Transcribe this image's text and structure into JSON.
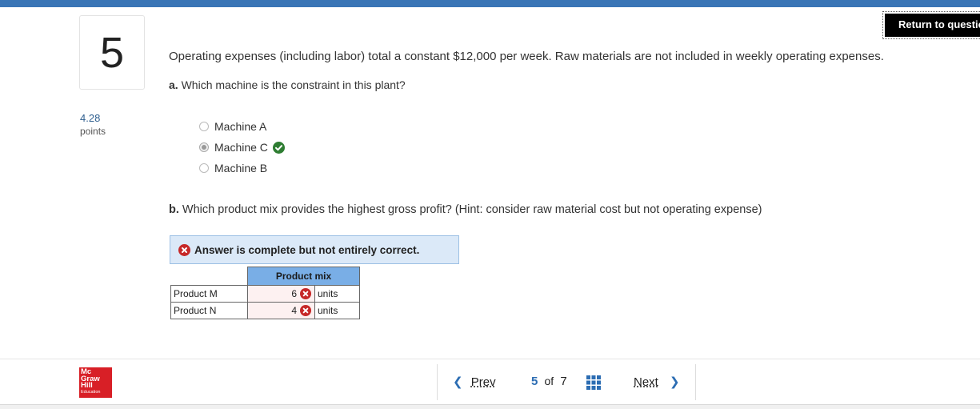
{
  "header": {
    "return_label": "Return to question"
  },
  "question": {
    "number": "5",
    "points_value": "4.28",
    "points_label": "points",
    "intro": "Operating expenses (including labor) total a constant $12,000 per week. Raw materials are not included in weekly operating expenses.",
    "part_a": {
      "prefix": "a.",
      "text": "Which machine is the constraint in this plant?",
      "options": [
        {
          "label": "Machine A",
          "selected": false
        },
        {
          "label": "Machine C",
          "selected": true,
          "correct": true
        },
        {
          "label": "Machine B",
          "selected": false
        }
      ]
    },
    "part_b": {
      "prefix": "b.",
      "text": "Which product mix provides the highest gross profit? (Hint: consider raw material cost but not operating expense)",
      "feedback": "Answer is complete but not entirely correct.",
      "table": {
        "header": "Product mix",
        "rows": [
          {
            "label": "Product M",
            "value": "6",
            "unit": "units",
            "correct": false
          },
          {
            "label": "Product N",
            "value": "4",
            "unit": "units",
            "correct": false
          }
        ]
      }
    }
  },
  "footer": {
    "logo": {
      "line1": "Mc",
      "line2": "Graw",
      "line3": "Hill",
      "line4": "Education"
    },
    "nav": {
      "prev_label": "Prev",
      "current": "5",
      "of_label": "of",
      "total": "7",
      "next_label": "Next"
    }
  },
  "colors": {
    "accent": "#3a75b6",
    "correct": "#2e7d32",
    "incorrect": "#c62828",
    "table_header": "#79aee6"
  }
}
